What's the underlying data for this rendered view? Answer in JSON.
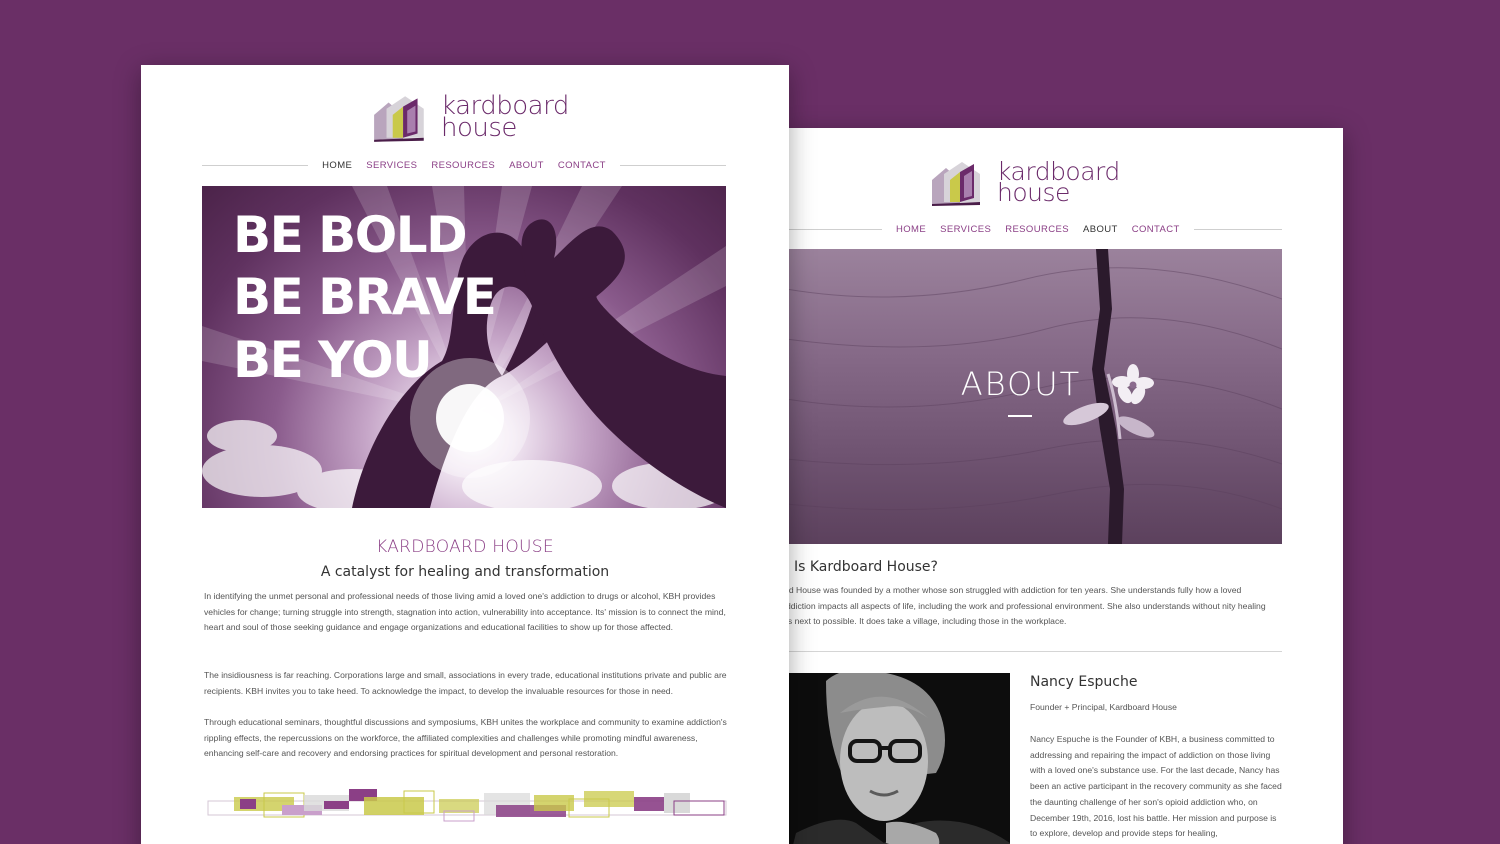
{
  "colors": {
    "background": "#6a2f66",
    "brand_purple": "#8b3f86",
    "logo_purple": "#6b2a6a",
    "accent_lime": "#c9c94a"
  },
  "left_page": {
    "logo": {
      "line1": "kardboard",
      "line2": "house",
      "icon": "house-logo-icon"
    },
    "nav": [
      {
        "label": "HOME",
        "active": true
      },
      {
        "label": "SERVICES",
        "active": false
      },
      {
        "label": "RESOURCES",
        "active": false
      },
      {
        "label": "ABOUT",
        "active": false
      },
      {
        "label": "CONTACT",
        "active": false
      }
    ],
    "hero": {
      "line1": "BE BOLD",
      "line2": "BE BRAVE",
      "line3": "BE YOU"
    },
    "title": "KARDBOARD HOUSE",
    "tagline": "A catalyst for healing and transformation",
    "paragraphs": [
      "In identifying the unmet personal and professional needs of those living amid a loved one's addiction to drugs or alcohol, KBH provides vehicles for change; turning struggle into strength, stagnation into action, vulnerability into acceptance. Its' mission is to connect the mind, heart and soul of those seeking guidance and engage organizations and educational facilities to show up for those affected.",
      "The insidiousness is far reaching. Corporations large and small, associations in every trade, educational institutions private and public are recipients.  KBH invites you to take heed. To acknowledge the impact, to develop the invaluable resources for those in need.",
      "Through educational seminars, thoughtful discussions and symposiums, KBH unites the workplace and community to examine addiction's rippling effects, the repercussions on the workforce, the affiliated complexities and challenges while promoting mindful awareness, enhancing self-care and recovery and endorsing practices for spiritual development and personal restoration."
    ]
  },
  "right_page": {
    "logo": {
      "line1": "kardboard",
      "line2": "house",
      "icon": "house-logo-icon"
    },
    "nav": [
      {
        "label": "HOME",
        "active": false
      },
      {
        "label": "SERVICES",
        "active": false
      },
      {
        "label": "RESOURCES",
        "active": false
      },
      {
        "label": "ABOUT",
        "active": true
      },
      {
        "label": "CONTACT",
        "active": false
      }
    ],
    "hero": {
      "title": "ABOUT"
    },
    "heading": "Is Kardboard House?",
    "paragraph": "rd House was founded by a mother whose son struggled with addiction for ten years.  She understands fully how a loved ddiction impacts all aspects of life, including the work and professional environment.  She also understands without nity healing is next to possible.  It does take a village, including those in the workplace.",
    "person": {
      "name": "Nancy Espuche",
      "role": "Founder + Principal, Kardboard House",
      "bio": "Nancy Espuche is the Founder of KBH, a business committed to addressing and repairing the impact of addiction on those living with a loved one's substance use.  For the last decade, Nancy has been an active participant in the recovery community as she faced the daunting challenge of her son's opioid addiction who, on December 19th, 2016, lost his battle.  Her mission and purpose is to explore, develop and provide steps for healing,"
    }
  }
}
